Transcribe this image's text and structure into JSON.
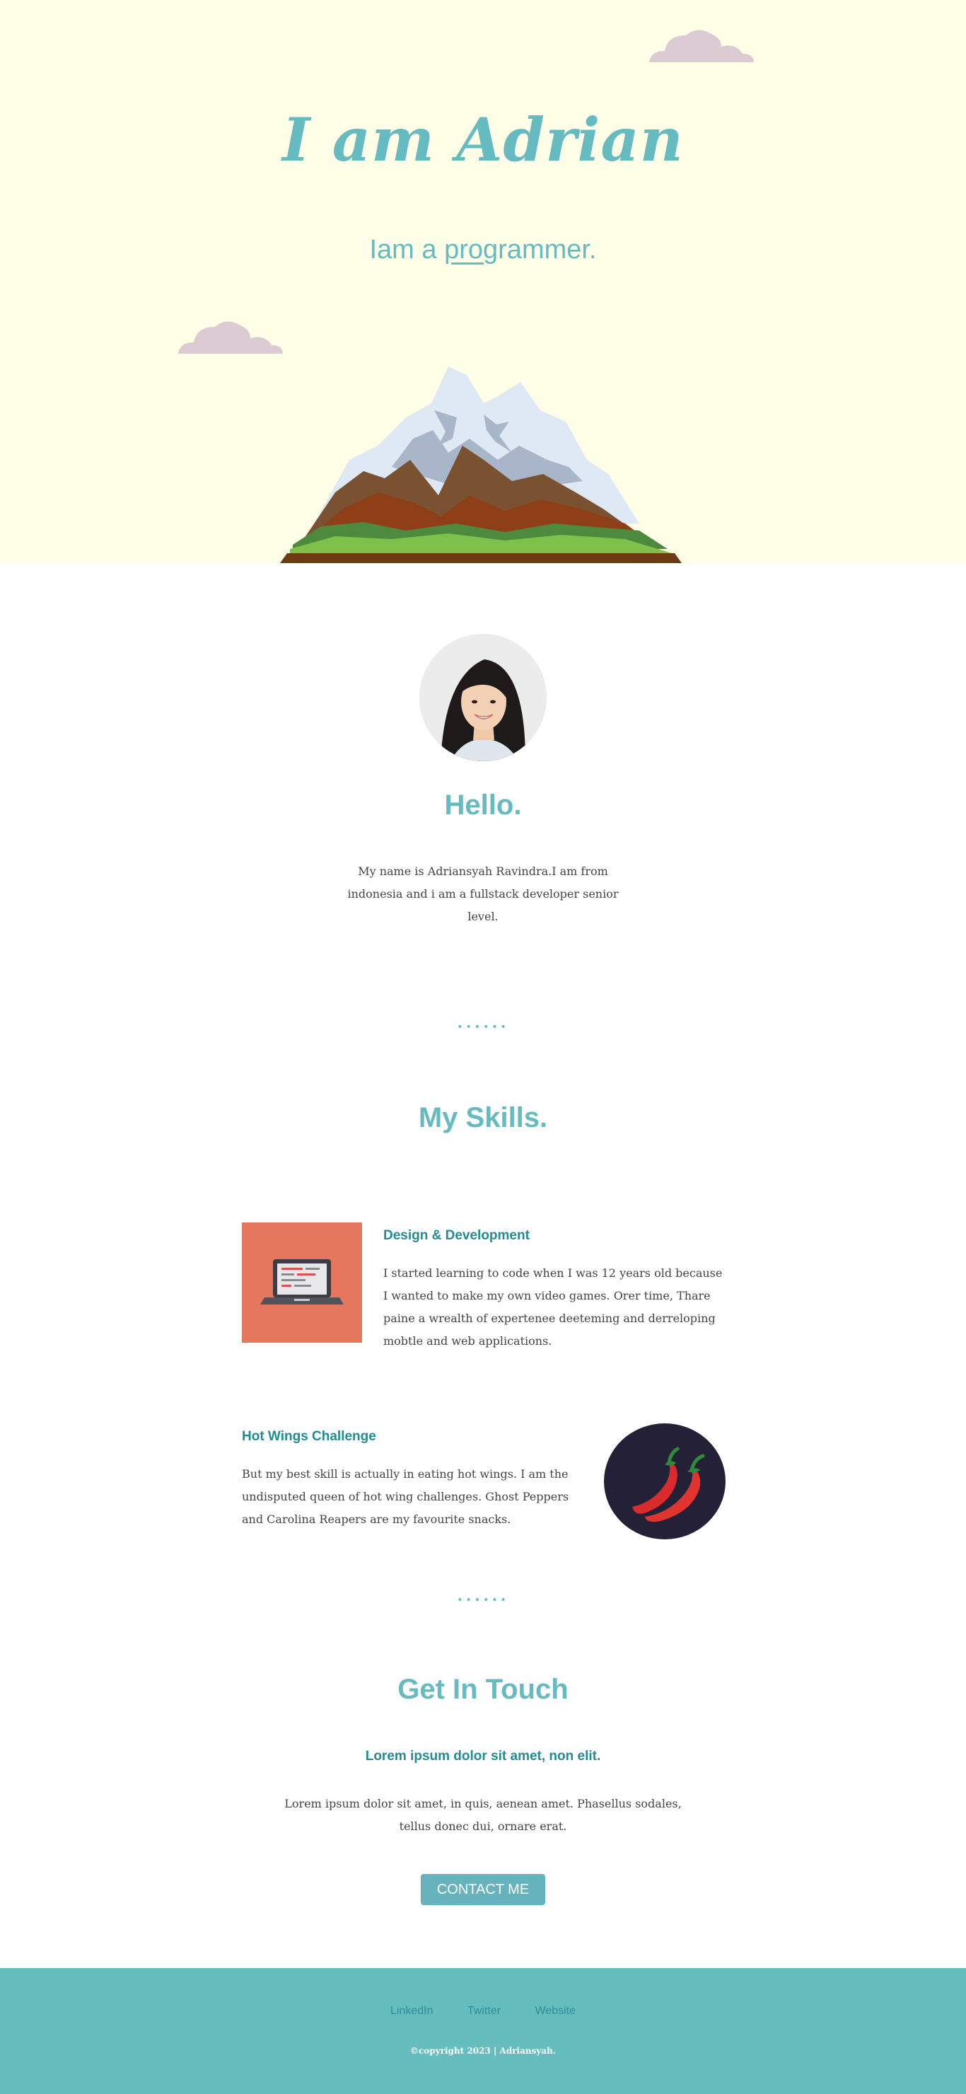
{
  "hero": {
    "title": "I am Adrian",
    "subtitle_prefix": "Iam a ",
    "subtitle_underlined": "prog",
    "subtitle_suffix": "rammer.",
    "background": "#fffee6",
    "accent": "#66bbc1"
  },
  "about": {
    "title": "Hello.",
    "text": "My name is Adriansyah Ravindra.I am from indonesia and i am a fullstack developer senior level."
  },
  "dividers": {
    "dots": "••••••"
  },
  "skills": {
    "title": "My Skills.",
    "items": [
      {
        "heading": "Design & Development",
        "text": "I started learning to code when I was 12 years old because I wanted to make my own video games. Orer time, Thare paine a wrealth of expertenee deeteming and derreloping mobtle and web applications.",
        "icon": "laptop-icon",
        "icon_bg": "#e4775e"
      },
      {
        "heading": "Hot Wings Challenge",
        "text": "But my best skill is actually in eating hot wings. I am the undisputed queen of hot wing challenges. Ghost Peppers and Carolina Reapers are my favourite snacks.",
        "icon": "chili-pepper-icon",
        "icon_bg": "#242038"
      }
    ]
  },
  "contact": {
    "title": "Get In Touch",
    "lead": "Lorem ipsum dolor sit amet, non elit.",
    "text": "Lorem ipsum dolor sit amet, in quis, aenean amet. Phasellus sodales, tellus donec dui, ornare erat.",
    "button_label": "CONTACT ME",
    "button_color": "#66b3be"
  },
  "footer": {
    "links": [
      "LinkedIn",
      "Twitter",
      "Website"
    ],
    "copyright": "©copyright 2023 | Adriansyah.",
    "background": "#66bdbd"
  }
}
